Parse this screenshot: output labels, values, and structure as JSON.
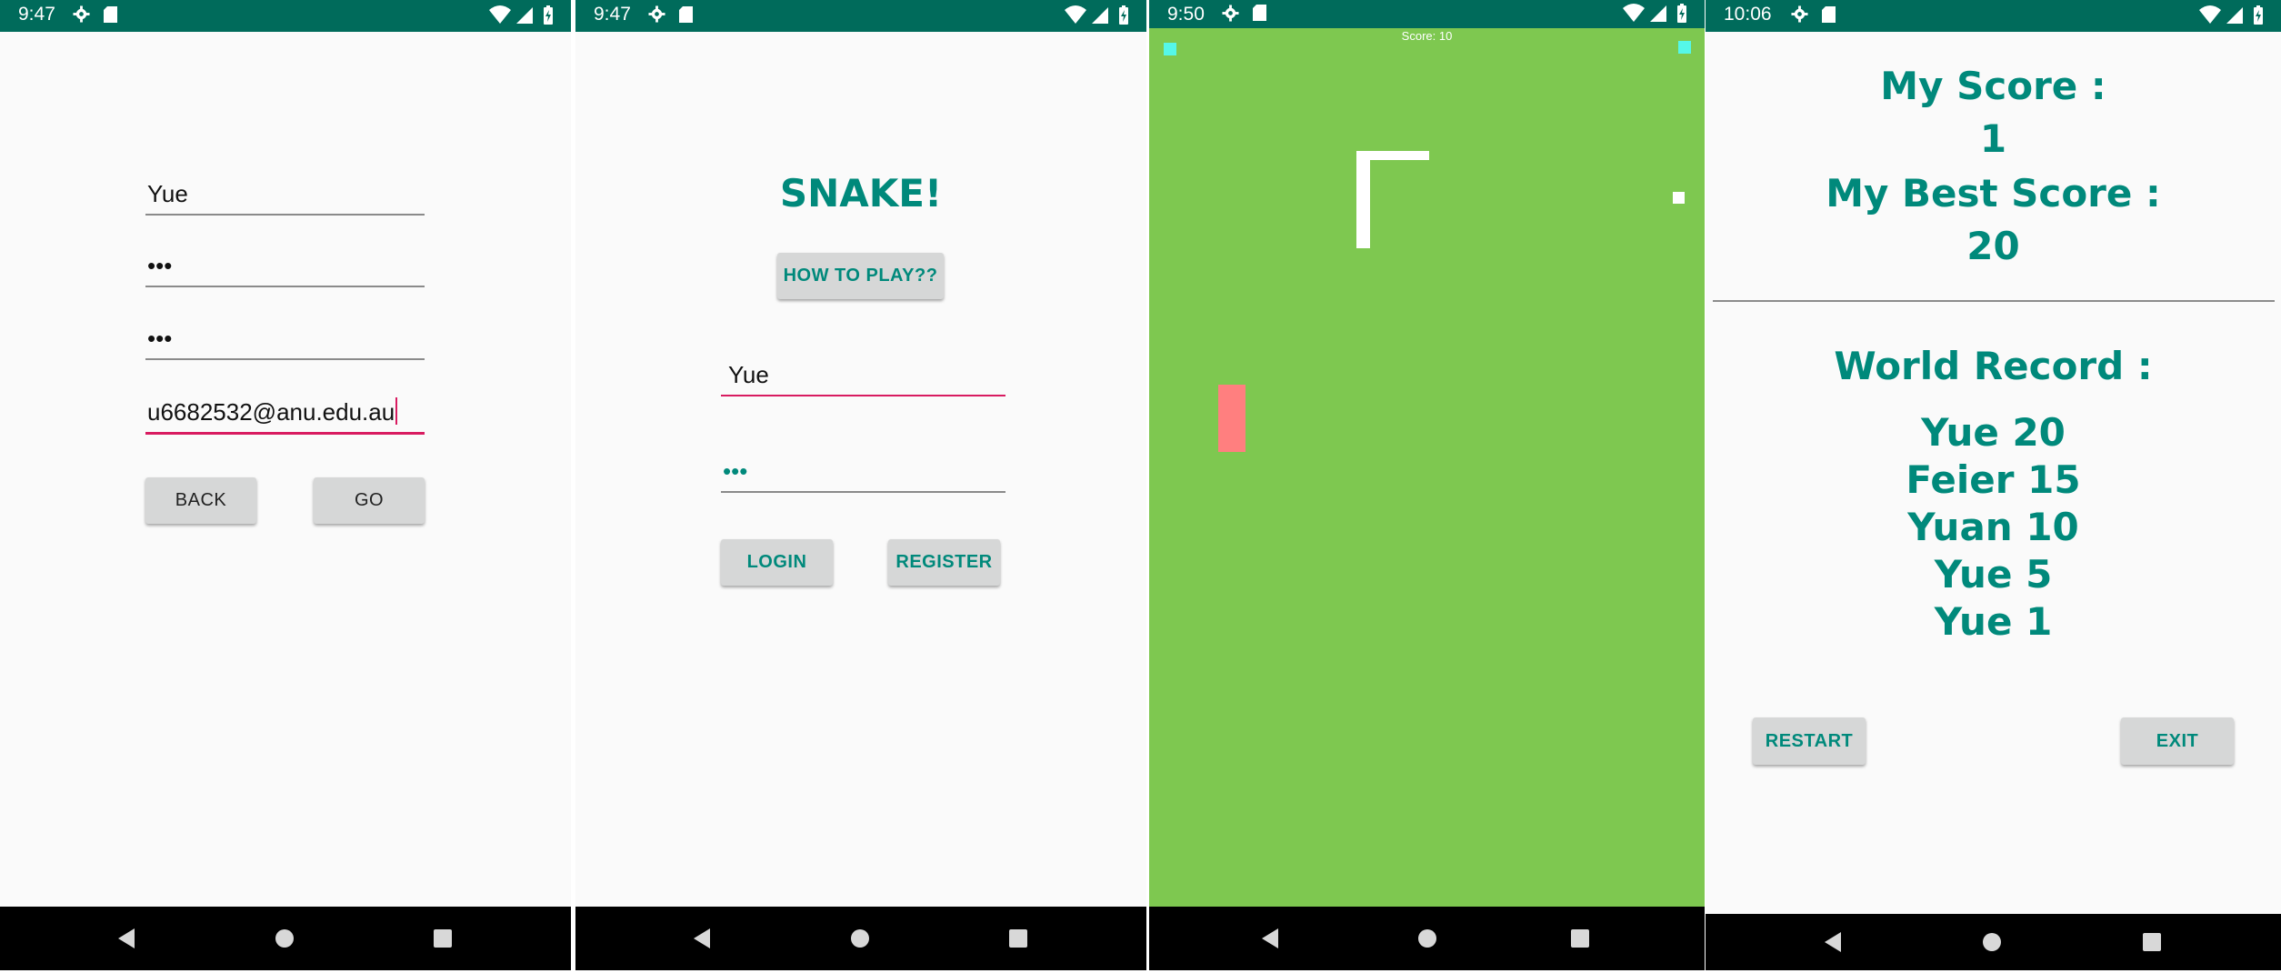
{
  "colors": {
    "status_bar": "#006b5b",
    "teal_text": "#00897b",
    "accent_underline": "#d81b60",
    "game_background": "#7ec850",
    "snake": "#ffffff",
    "food": "#ff7f7f",
    "corner_marker": "#55f7e8",
    "button_background": "#d6d7d7"
  },
  "icons": [
    "gear-icon",
    "sd-card-icon",
    "wifi-icon",
    "signal-icon",
    "battery-icon",
    "nav-back-icon",
    "nav-home-icon",
    "nav-recent-icon"
  ],
  "register_screen": {
    "time": "9:47",
    "username_value": "Yue",
    "password_value": "•••",
    "confirm_password_value": "•••",
    "email_value": "u6682532@anu.edu.au",
    "back_label": "BACK",
    "go_label": "GO"
  },
  "login_screen": {
    "time": "9:47",
    "title": "SNAKE!",
    "how_to_play_label": "HOW TO PLAY??",
    "username_value": "Yue",
    "password_value": "•••",
    "login_label": "LOGIN",
    "register_label": "REGISTER"
  },
  "game_screen": {
    "time": "9:50",
    "score_text": "Score: 10"
  },
  "score_screen": {
    "time": "10:06",
    "my_score_label": "My Score :",
    "my_score_value": "1",
    "best_score_label": "My Best Score :",
    "best_score_value": "20",
    "world_record_label": "World Record :",
    "records": [
      "Yue 20",
      "Feier 15",
      "Yuan 10",
      "Yue 5",
      "Yue 1"
    ],
    "restart_label": "RESTART",
    "exit_label": "EXIT"
  }
}
